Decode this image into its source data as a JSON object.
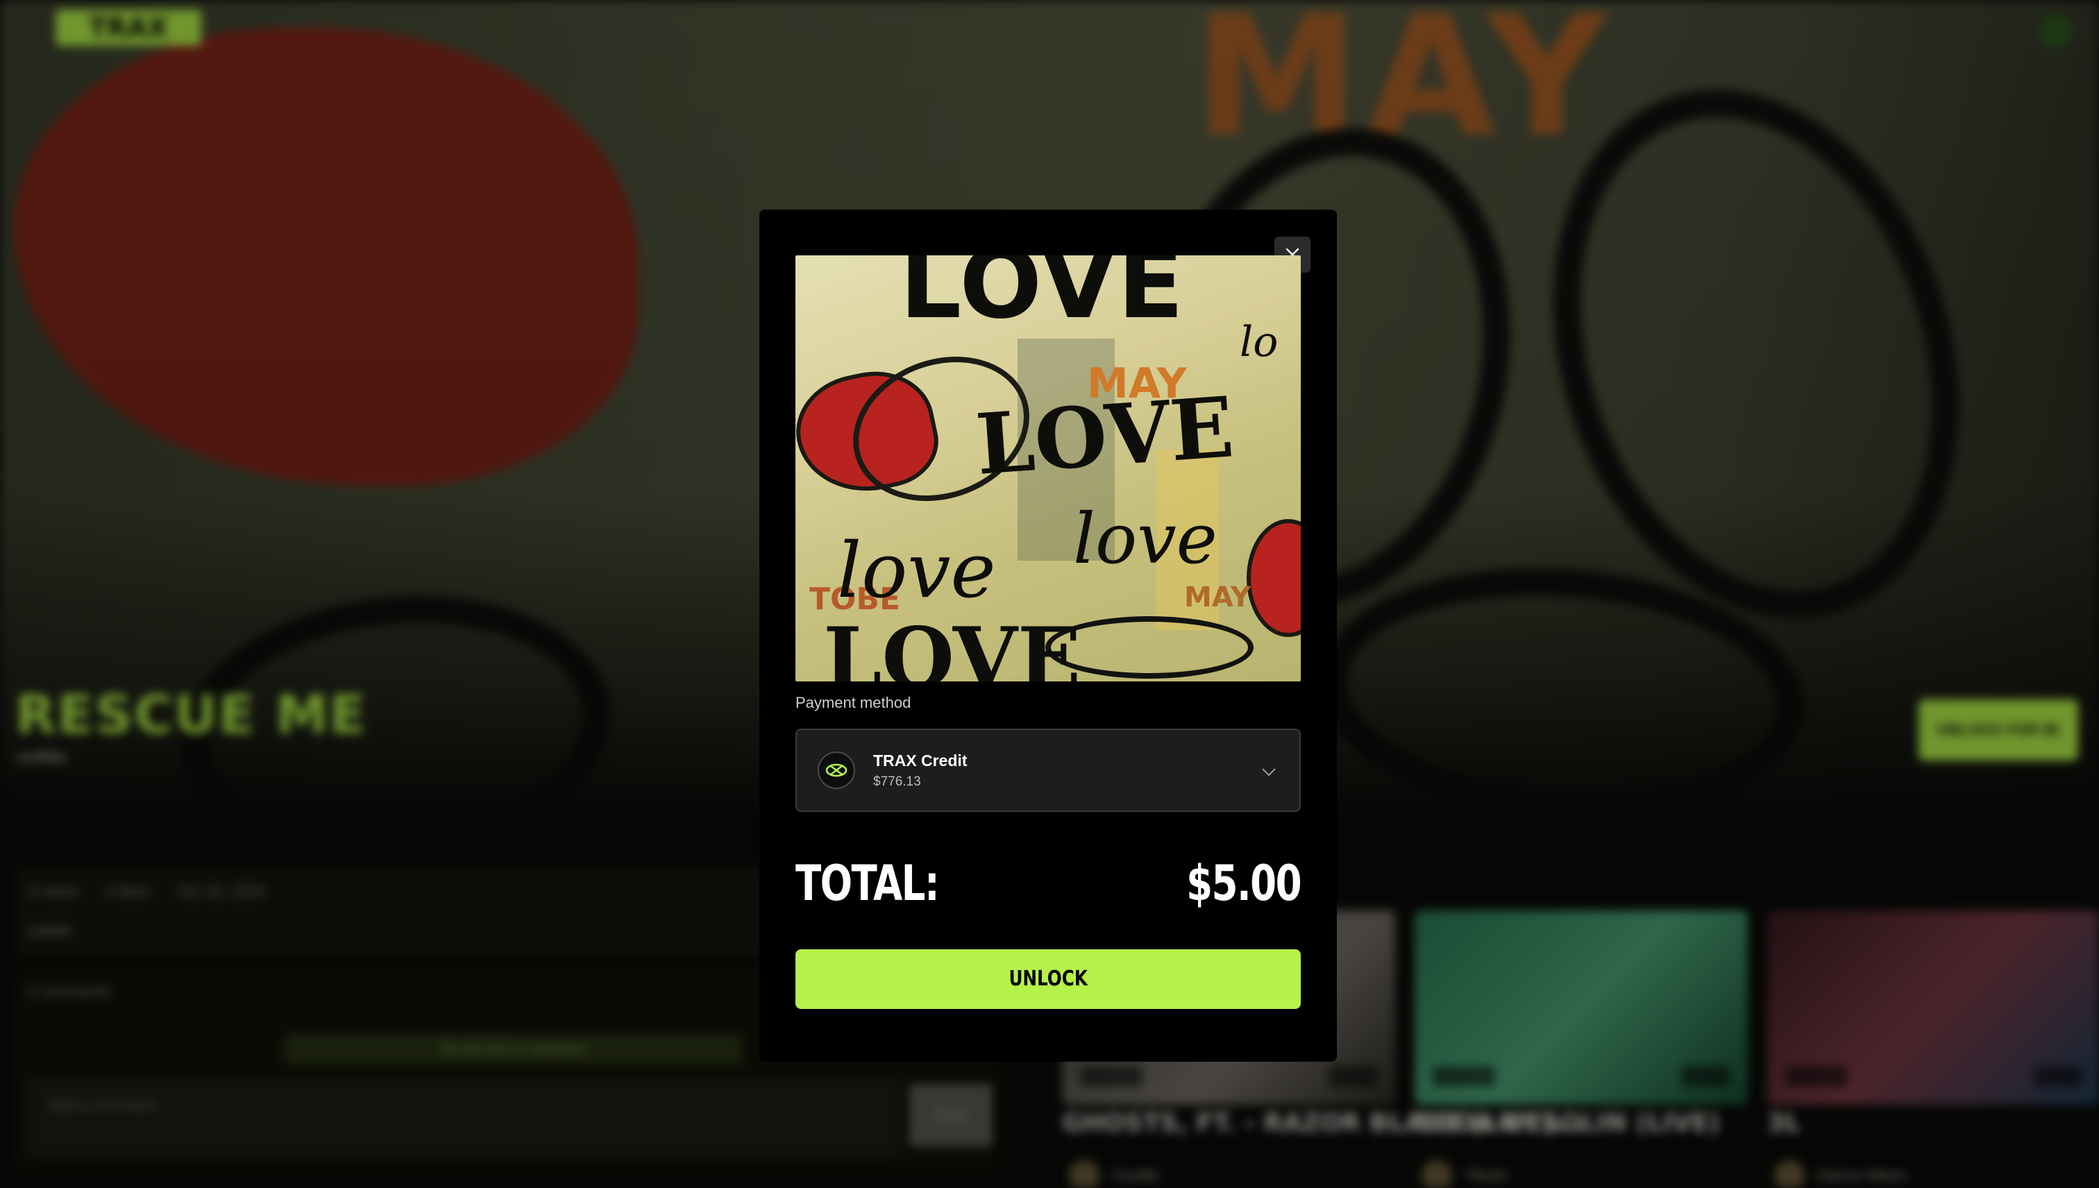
{
  "background": {
    "logo_text": "TRAX",
    "song_title": "RESCUE ME",
    "song_artist": "surfbby",
    "unlock_button_label": "UNLOCK FOR $5",
    "meta": [
      "0 views",
      "0 likes",
      "Oct 26, 2024"
    ],
    "meta_sub": "Lorem",
    "comments_count": "0 comments",
    "comments_banner": "Be the first to comment",
    "comment_placeholder": "Add a comment",
    "post_label": "Post",
    "videos": [
      {
        "title": "GHOSTS, FT. - RAZOR BLADE (LIVE)...",
        "author": "Coulibi"
      },
      {
        "title": "BODA DESOLIN (LIVE)",
        "author": "Tibrah"
      },
      {
        "title": "3L",
        "author": "Danny Alkers"
      }
    ]
  },
  "modal": {
    "artwork_words": {
      "top": "LOVE",
      "middle": "LOVE",
      "low_left": "love",
      "low_right": "love",
      "bottom": "LOVE",
      "small": "lo",
      "orange_1": "MAY",
      "orange_2": "TOBE",
      "orange_3": "MAY"
    },
    "payment_method_label": "Payment method",
    "payment": {
      "name": "TRAX Credit",
      "balance": "$776.13",
      "icon": "trax-credit-icon"
    },
    "total_label": "TOTAL:",
    "total_value": "$5.00",
    "unlock_label": "UNLOCK"
  },
  "colors": {
    "accent": "#b6f24a",
    "modal_bg": "#000000",
    "select_bg": "#1d1d1d"
  }
}
